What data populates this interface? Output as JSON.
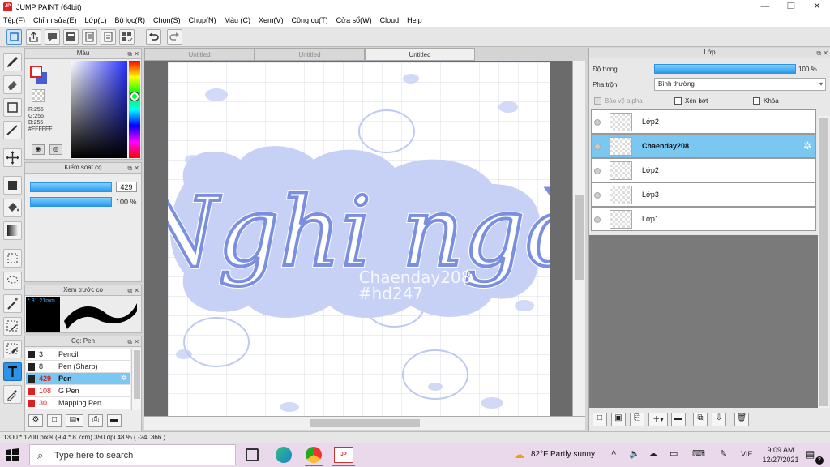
{
  "window": {
    "title": "JUMP PAINT (64bit)",
    "minimize": "—",
    "maximize": "❐",
    "close": "✕"
  },
  "menu": [
    "Tệp(F)",
    "Chỉnh sửa(E)",
    "Lớp(L)",
    "Bộ lọc(R)",
    "Chọn(S)",
    "Chụp(N)",
    "Màu (C)",
    "Xem(V)",
    "Công cụ(T)",
    "Cửa sổ(W)",
    "Cloud",
    "Help"
  ],
  "tabs": [
    {
      "label": "Untitled",
      "active": false
    },
    {
      "label": "Untitled",
      "active": false
    },
    {
      "label": "Untitled",
      "active": true
    }
  ],
  "color_panel": {
    "title": "Màu",
    "rgb": {
      "r": "R:255",
      "g": "G:255",
      "b": "B:255",
      "hex": "#FFFFFF"
    },
    "main_color": "#ffffff",
    "sub_color": "#4a5bd6"
  },
  "brush_control": {
    "title": "Kiểm soát cọ",
    "size": "429",
    "opacity": "100 %"
  },
  "brush_preview": {
    "title": "Xem trước cọ",
    "size_label": "31.21mm"
  },
  "brushes": {
    "title": "Cọ: Pen",
    "items": [
      {
        "num": "3",
        "name": "Pencil",
        "color": "#222222",
        "selected": false
      },
      {
        "num": "8",
        "name": "Pen (Sharp)",
        "color": "#222222",
        "selected": false
      },
      {
        "num": "429",
        "name": "Pen",
        "color": "#222222",
        "selected": true
      },
      {
        "num": "108",
        "name": "G Pen",
        "color": "#e02020",
        "selected": false
      },
      {
        "num": "30",
        "name": "Mapping Pen",
        "color": "#e02020",
        "selected": false
      }
    ]
  },
  "artwork": {
    "main_text": "Nghi ngờ",
    "watermark_line1": "Chaenday208",
    "watermark_line2": "#hd247"
  },
  "layers_panel": {
    "title": "Lớp",
    "opacity_label": "Độ trong",
    "opacity_value": "100 %",
    "opacity_fraction": 1.0,
    "blend_label": "Pha trộn",
    "blend_value": "Bình thường",
    "protect_alpha": "Bảo vệ alpha",
    "clipping": "Xén bớt",
    "lock": "Khóa",
    "layers": [
      {
        "name": "Lớp2",
        "selected": false
      },
      {
        "name": "Chaenday208",
        "selected": true
      },
      {
        "name": "Lớp2",
        "selected": false
      },
      {
        "name": "Lớp3",
        "selected": false
      },
      {
        "name": "Lớp1",
        "selected": false
      }
    ]
  },
  "status": {
    "pixels": "1300 * 1200 pixel",
    "size": "(9.4 * 8.7cm)",
    "dpi": "350 dpi",
    "zoom": "48 %",
    "coords": "( -24, 366 )"
  },
  "taskbar": {
    "search_placeholder": "Type here to search",
    "weather": "82°F  Partly sunny",
    "lang": "VIE",
    "time": "9:09 AM",
    "date": "12/27/2021",
    "notif_count": "2"
  },
  "colors": {
    "accent": "#2b93e8",
    "layer_selected": "#7ac8f2",
    "art_blue": "#7b8fe0",
    "art_light": "#c9d3f4"
  }
}
